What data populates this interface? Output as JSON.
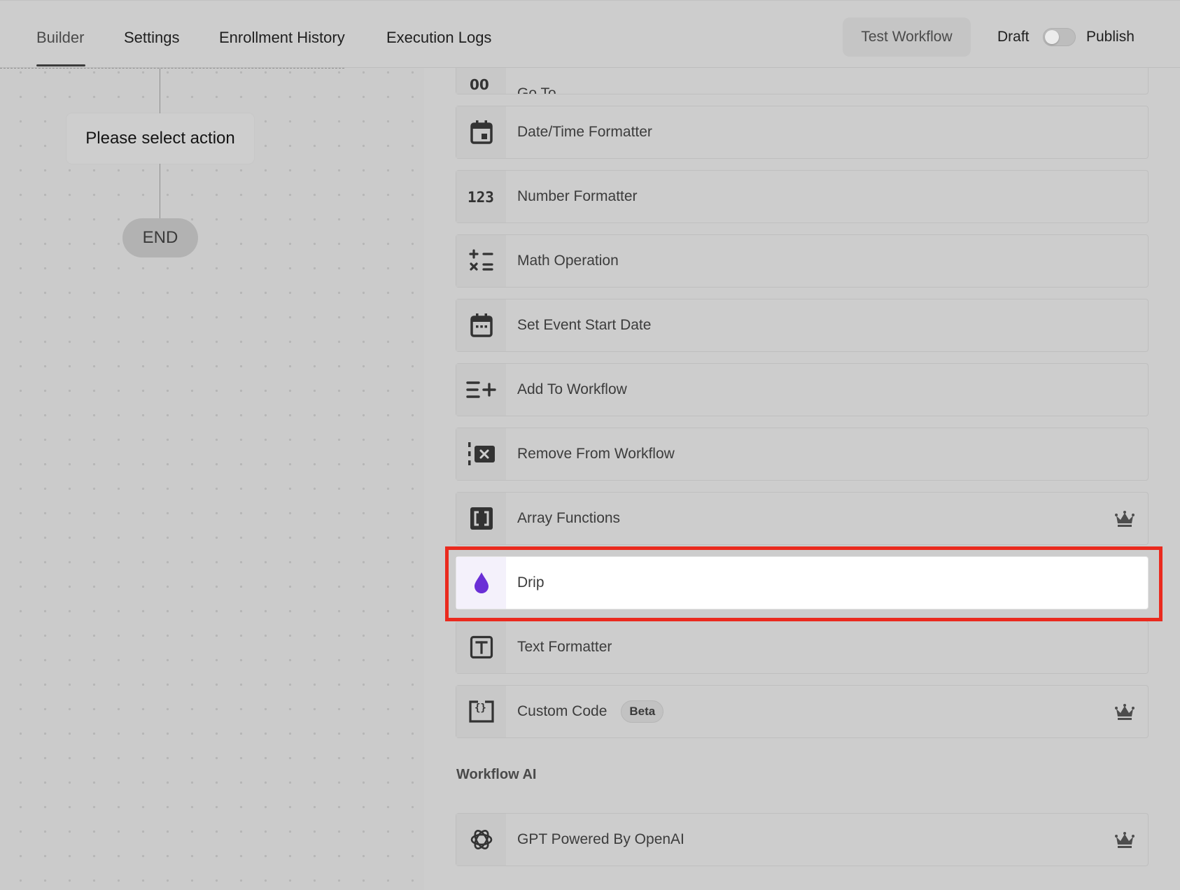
{
  "header": {
    "tabs": [
      {
        "label": "Builder"
      },
      {
        "label": "Settings"
      },
      {
        "label": "Enrollment History"
      },
      {
        "label": "Execution Logs"
      }
    ],
    "test_workflow_label": "Test Workflow",
    "draft_label": "Draft",
    "publish_label": "Publish",
    "publish_toggle_on": false
  },
  "canvas": {
    "select_action_label": "Please select action",
    "end_label": "END"
  },
  "actions": {
    "partial_top_label": "Go To",
    "items": [
      {
        "label": "Date/Time Formatter",
        "icon": "calendar-icon"
      },
      {
        "label": "Number Formatter",
        "icon": "number-123-icon"
      },
      {
        "label": "Math Operation",
        "icon": "math-operators-icon"
      },
      {
        "label": "Set Event Start Date",
        "icon": "event-calendar-icon"
      },
      {
        "label": "Add To Workflow",
        "icon": "list-add-icon"
      },
      {
        "label": "Remove From Workflow",
        "icon": "remove-box-icon"
      },
      {
        "label": "Array Functions",
        "icon": "array-brackets-icon",
        "premium": true
      },
      {
        "label": "Drip",
        "icon": "drop-icon",
        "selected": true
      },
      {
        "label": "Text Formatter",
        "icon": "text-t-icon"
      },
      {
        "label": "Custom Code",
        "icon": "code-braces-icon",
        "badge": "Beta",
        "premium": true
      }
    ],
    "section_title": "Workflow AI",
    "ai_items": [
      {
        "label": "GPT Powered By OpenAI",
        "icon": "openai-icon",
        "premium": true
      }
    ]
  },
  "colors": {
    "highlight_border": "#ea2a1e",
    "drip_icon": "#6a2fd6"
  }
}
